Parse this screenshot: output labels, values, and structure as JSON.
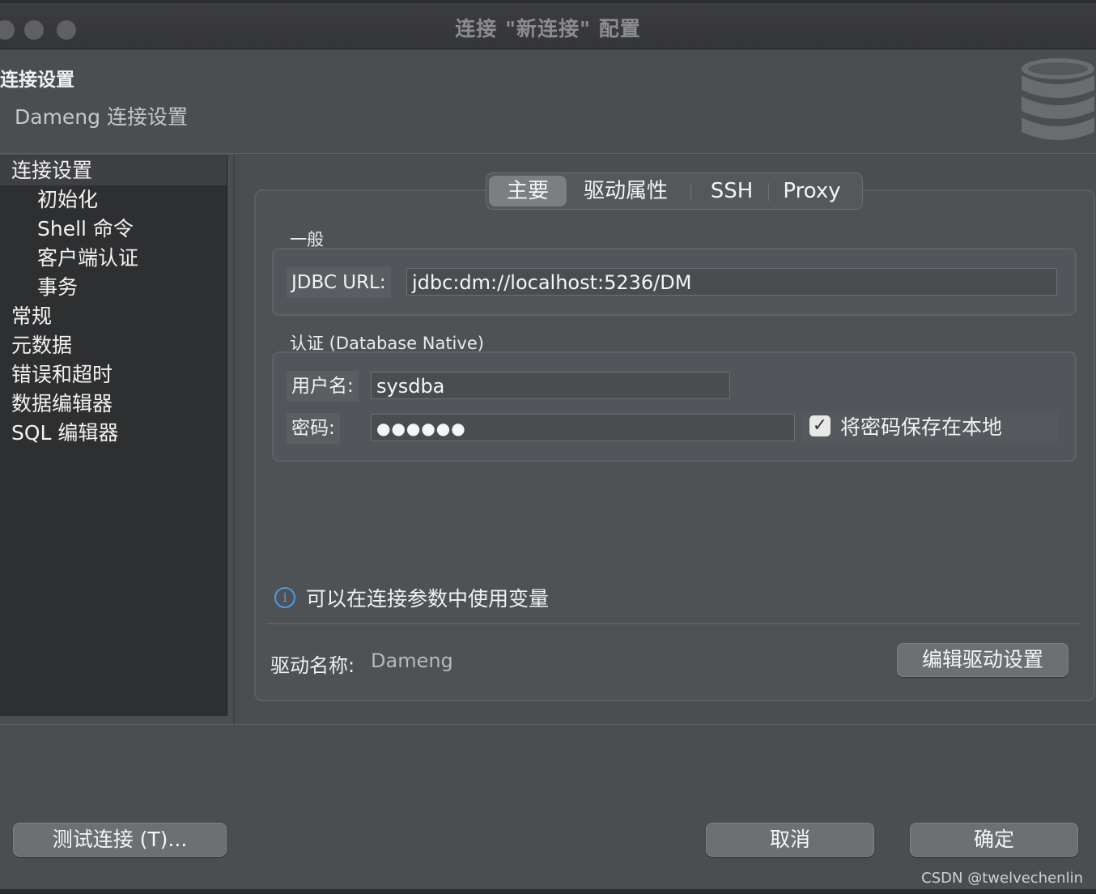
{
  "window": {
    "title": "连接 \"新连接\" 配置"
  },
  "header": {
    "title": "连接设置",
    "subtitle": "Dameng 连接设置",
    "icon": "database-icon"
  },
  "sidebar": {
    "items": [
      {
        "label": "连接设置",
        "selected": true
      },
      {
        "label": "初始化"
      },
      {
        "label": "Shell 命令"
      },
      {
        "label": "客户端认证"
      },
      {
        "label": "事务"
      },
      {
        "label": "常规"
      },
      {
        "label": "元数据"
      },
      {
        "label": "错误和超时"
      },
      {
        "label": "数据编辑器"
      },
      {
        "label": "SQL 编辑器"
      }
    ]
  },
  "tabs": [
    {
      "label": "主要",
      "active": true
    },
    {
      "label": "驱动属性"
    },
    {
      "label": "SSH"
    },
    {
      "label": "Proxy"
    }
  ],
  "general": {
    "label": "一般",
    "jdbc_label": "JDBC URL:",
    "jdbc_value": "jdbc:dm://localhost:5236/DM"
  },
  "auth": {
    "label": "认证 (Database Native)",
    "username_label": "用户名:",
    "username_value": "sysdba",
    "password_label": "密码:",
    "password_value": "●●●●●●",
    "save_password_label": "将密码保存在本地",
    "save_password_checked": true
  },
  "info": {
    "text": "可以在连接参数中使用变量",
    "icon": "info-icon"
  },
  "driver": {
    "label": "驱动名称:",
    "value": "Dameng",
    "edit_button": "编辑驱动设置"
  },
  "footer": {
    "test_button": "测试连接 (T)...",
    "cancel_button": "取消",
    "ok_button": "确定",
    "watermark": "CSDN @twelvechenlin"
  },
  "colors": {
    "info_accent": "#4c9be8",
    "background": "#4b4e51",
    "sidebar": "#2e2f31"
  }
}
